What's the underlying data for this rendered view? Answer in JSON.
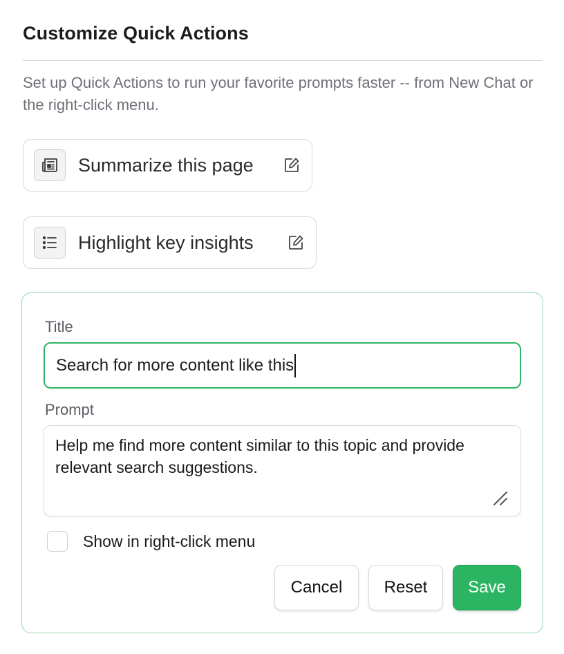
{
  "page": {
    "title": "Customize Quick Actions",
    "description": "Set up Quick Actions to run your favorite prompts faster -- from New Chat or the right-click menu."
  },
  "quick_actions": [
    {
      "label": "Summarize this page",
      "icon": "newspaper-icon",
      "edit_icon": "edit-icon"
    },
    {
      "label": "Highlight key insights",
      "icon": "list-icon",
      "edit_icon": "edit-icon"
    }
  ],
  "editor": {
    "title_label": "Title",
    "title_value": "Search for more content like this",
    "prompt_label": "Prompt",
    "prompt_value": "Help me find more content similar to this topic and provide relevant search suggestions.",
    "checkbox_label": "Show in right-click menu",
    "checkbox_checked": false,
    "cancel_label": "Cancel",
    "reset_label": "Reset",
    "save_label": "Save"
  },
  "colors": {
    "accent": "#2bb562",
    "accent_border": "#8fd9a8",
    "muted_text": "#6e7178"
  }
}
